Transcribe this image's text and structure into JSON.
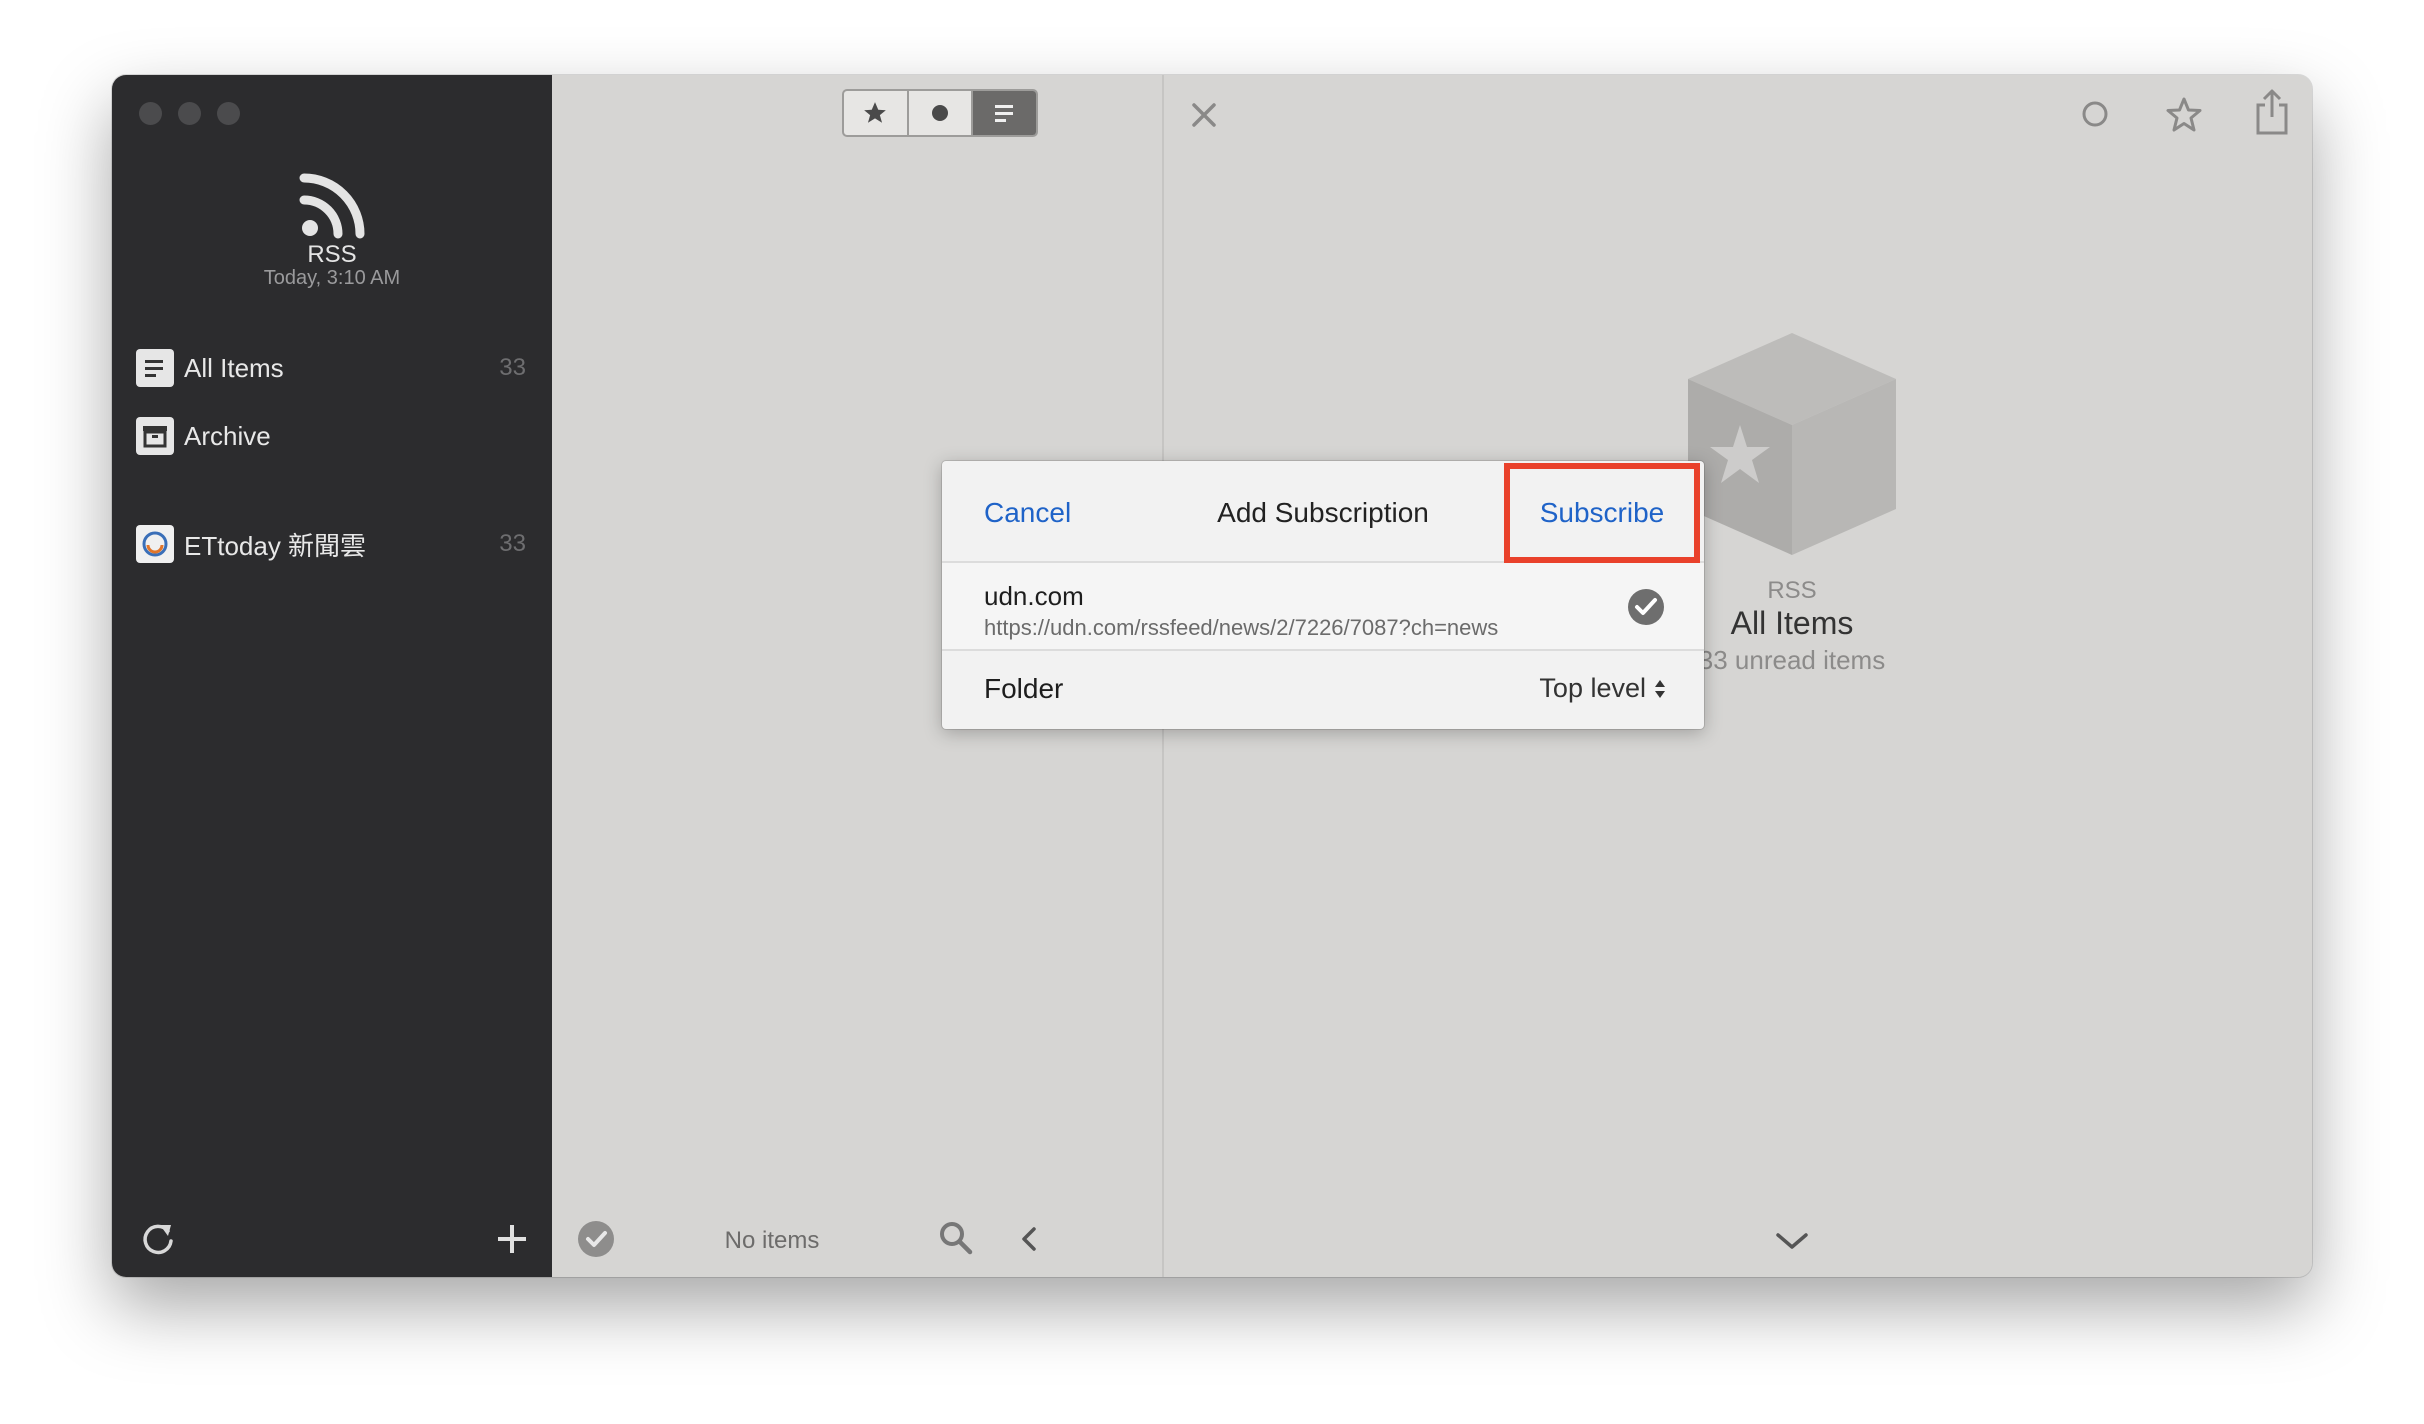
{
  "sidebar": {
    "title": "RSS",
    "subtitle": "Today, 3:10 AM",
    "items": [
      {
        "label": "All Items",
        "count": "33"
      },
      {
        "label": "Archive",
        "count": ""
      },
      {
        "label": "ETtoday 新聞雲",
        "count": "33"
      }
    ]
  },
  "list": {
    "footer_label": "No items"
  },
  "detail": {
    "source": "RSS",
    "title": "All Items",
    "subtitle": "33 unread items"
  },
  "dialog": {
    "cancel_label": "Cancel",
    "title": "Add Subscription",
    "subscribe_label": "Subscribe",
    "feed_domain": "udn.com",
    "feed_url": "https://udn.com/rssfeed/news/2/7226/7087?ch=news",
    "folder_label": "Folder",
    "folder_value": "Top level"
  },
  "colors": {
    "accent": "#1f63c8",
    "highlight": "#e9412b",
    "sidebar_bg": "#2c2c2e"
  }
}
